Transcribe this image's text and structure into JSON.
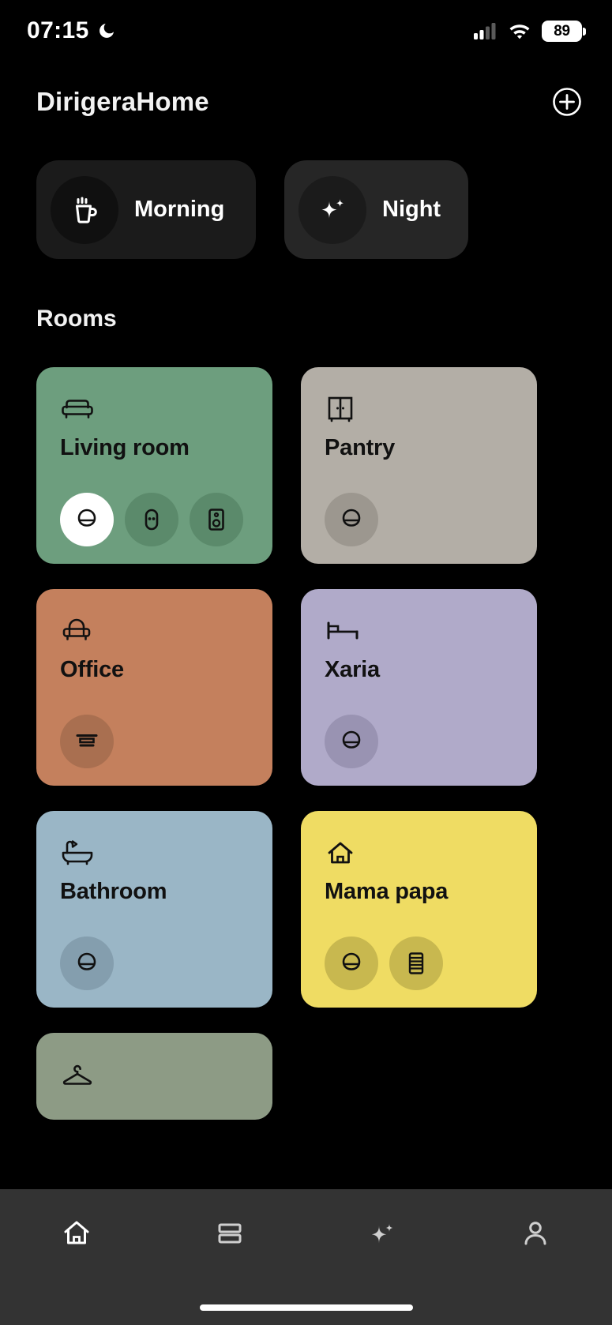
{
  "status_bar": {
    "time": "07:15",
    "dnd_icon": "moon-icon",
    "signal_icon": "cellular-signal-icon",
    "signal_bars_filled": 2,
    "signal_bars_total": 4,
    "wifi_icon": "wifi-icon",
    "battery_level": "89",
    "battery_icon": "battery-icon"
  },
  "header": {
    "title": "DirigeraHome",
    "add_icon": "plus-circle-icon"
  },
  "scenes": [
    {
      "label": "Morning",
      "icon": "coffee-cup-icon"
    },
    {
      "label": "Night",
      "icon": "sparkle-icon"
    }
  ],
  "sections": {
    "rooms_title": "Rooms"
  },
  "rooms": [
    {
      "name": "Living room",
      "icon": "sofa-icon",
      "color": "#6d9e7e",
      "chip_off_color": "#5b8a6b",
      "text_color": "#111111",
      "devices": [
        {
          "icon": "light-bulb-icon",
          "state": "on"
        },
        {
          "icon": "remote-control-icon",
          "state": "off"
        },
        {
          "icon": "speaker-icon",
          "state": "off"
        }
      ]
    },
    {
      "name": "Pantry",
      "icon": "cabinet-icon",
      "color": "#b3aea6",
      "chip_off_color": "#9c978f",
      "text_color": "#111111",
      "devices": [
        {
          "icon": "light-bulb-icon",
          "state": "off"
        }
      ]
    },
    {
      "name": "Office",
      "icon": "armchair-icon",
      "color": "#c4805d",
      "chip_off_color": "#a96f50",
      "text_color": "#111111",
      "devices": [
        {
          "icon": "blinds-icon",
          "state": "off"
        }
      ]
    },
    {
      "name": "Xaria",
      "icon": "bed-icon",
      "color": "#b0aac9",
      "chip_off_color": "#9993b2",
      "text_color": "#111111",
      "devices": [
        {
          "icon": "light-bulb-icon",
          "state": "off"
        }
      ]
    },
    {
      "name": "Bathroom",
      "icon": "bathtub-icon",
      "color": "#9ab6c6",
      "chip_off_color": "#849eae",
      "text_color": "#111111",
      "devices": [
        {
          "icon": "light-bulb-icon",
          "state": "off"
        }
      ]
    },
    {
      "name": "Mama papa",
      "icon": "house-icon",
      "color": "#efdc63",
      "chip_off_color": "#c8b84f",
      "text_color": "#111111",
      "devices": [
        {
          "icon": "light-bulb-icon",
          "state": "off"
        },
        {
          "icon": "blinds-stack-icon",
          "state": "off"
        }
      ]
    },
    {
      "name": "",
      "icon": "clothes-hanger-icon",
      "color": "#8d9b85",
      "chip_off_color": "#7a876f",
      "text_color": "#111111",
      "devices": []
    }
  ],
  "bottom_nav": [
    {
      "icon": "home-icon",
      "active": true
    },
    {
      "icon": "devices-icon",
      "active": false
    },
    {
      "icon": "sparkle-icon",
      "active": false
    },
    {
      "icon": "person-icon",
      "active": false
    }
  ]
}
